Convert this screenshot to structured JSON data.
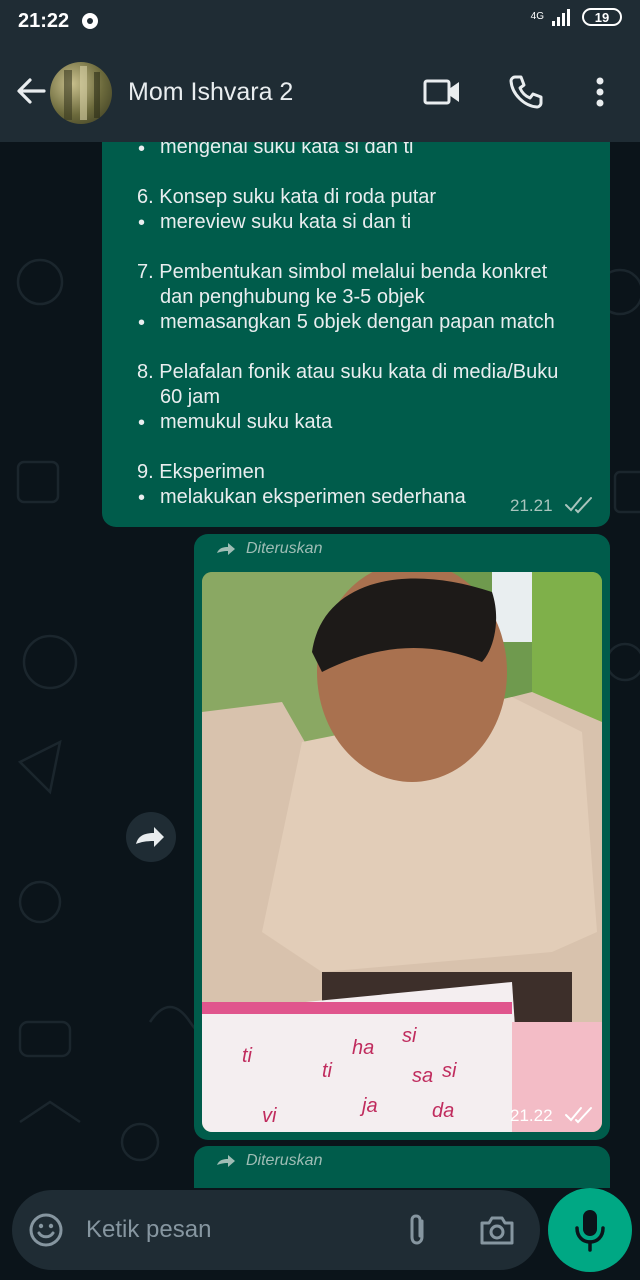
{
  "status_bar": {
    "time": "21:22",
    "network": "4G",
    "battery": "19"
  },
  "header": {
    "contact_name": "Mom Ishvara 2"
  },
  "message1": {
    "lines": [
      "mengenal suku kata si dan ti",
      "6. Konsep suku kata di roda putar",
      "mereview suku kata si dan ti",
      "7. Pembentukan simbol melalui benda konkret",
      "dan penghubung ke 3-5 objek",
      "memasangkan 5 objek dengan papan match",
      "8. Pelafalan fonik atau suku kata di media/Buku",
      "60 jam",
      "memukul suku kata",
      "9. Eksperimen",
      "melakukan eksperimen sederhana"
    ],
    "bullet": "•",
    "time": "21.21"
  },
  "message2": {
    "forwarded_label": "Diteruskan",
    "time": "21.22"
  },
  "message3": {
    "forwarded_label": "Diteruskan"
  },
  "input": {
    "placeholder": "Ketik pesan"
  },
  "colors": {
    "bubble_out": "#005c4b",
    "accent": "#00a884",
    "bar": "#1f2c34",
    "background": "#0b141a"
  },
  "icons": [
    "back-arrow-icon",
    "video-call-icon",
    "phone-icon",
    "more-options-icon",
    "forward-icon",
    "double-check-icon",
    "emoji-icon",
    "attach-icon",
    "camera-icon",
    "mic-icon",
    "notification-icon",
    "signal-icon",
    "battery-icon"
  ]
}
